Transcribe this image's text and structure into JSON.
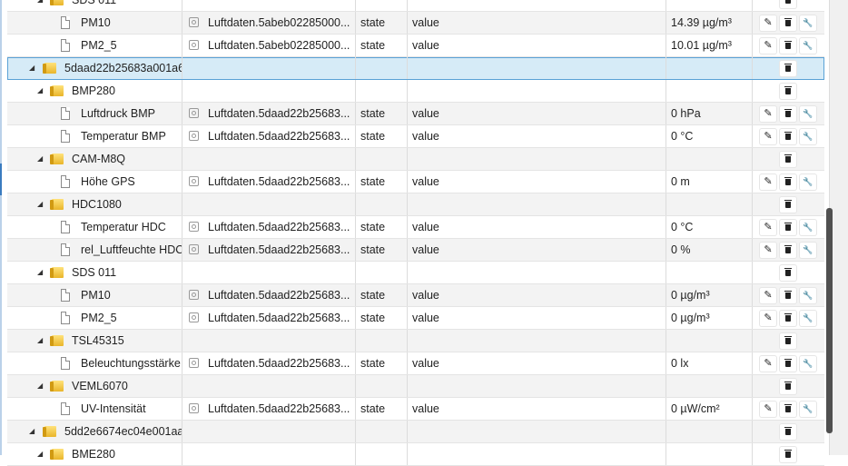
{
  "icons": {
    "expand": "triangle-down-icon",
    "folder": "folder-icon",
    "state": "document-icon",
    "object": "object-state-icon",
    "edit": "pencil-icon",
    "delete": "trash-icon",
    "settings": "wrench-icon"
  },
  "colors": {
    "selected_bg": "#d6ebf7",
    "selected_border": "#5aa2d6",
    "folder": "#e9b52a"
  },
  "rows": [
    {
      "kind": "folder",
      "level": 1,
      "name": "SDS 011",
      "actions": "delete"
    },
    {
      "kind": "state",
      "level": 2,
      "name": "PM10",
      "id": "Luftdaten.5abeb02285000...",
      "role": "state",
      "type": "value",
      "value": "14.39 µg/m³",
      "actions": "all"
    },
    {
      "kind": "state",
      "level": 2,
      "name": "PM2_5",
      "id": "Luftdaten.5abeb02285000...",
      "role": "state",
      "type": "value",
      "value": "10.01 µg/m³",
      "actions": "all"
    },
    {
      "kind": "folder",
      "level": 0,
      "name": "5daad22b25683a001a6",
      "actions": "delete",
      "selected": true
    },
    {
      "kind": "folder",
      "level": 1,
      "name": "BMP280",
      "actions": "delete"
    },
    {
      "kind": "state",
      "level": 2,
      "name": "Luftdruck BMP",
      "id": "Luftdaten.5daad22b25683...",
      "role": "state",
      "type": "value",
      "value": "0 hPa",
      "actions": "all"
    },
    {
      "kind": "state",
      "level": 2,
      "name": "Temperatur BMP",
      "id": "Luftdaten.5daad22b25683...",
      "role": "state",
      "type": "value",
      "value": "0 °C",
      "actions": "all"
    },
    {
      "kind": "folder",
      "level": 1,
      "name": "CAM-M8Q",
      "actions": "delete"
    },
    {
      "kind": "state",
      "level": 2,
      "name": "Höhe GPS",
      "id": "Luftdaten.5daad22b25683...",
      "role": "state",
      "type": "value",
      "value": "0 m",
      "actions": "all"
    },
    {
      "kind": "folder",
      "level": 1,
      "name": "HDC1080",
      "actions": "delete"
    },
    {
      "kind": "state",
      "level": 2,
      "name": "Temperatur HDC",
      "id": "Luftdaten.5daad22b25683...",
      "role": "state",
      "type": "value",
      "value": "0 °C",
      "actions": "all"
    },
    {
      "kind": "state",
      "level": 2,
      "name": "rel_Luftfeuchte HDC",
      "id": "Luftdaten.5daad22b25683...",
      "role": "state",
      "type": "value",
      "value": "0 %",
      "actions": "all"
    },
    {
      "kind": "folder",
      "level": 1,
      "name": "SDS 011",
      "actions": "delete"
    },
    {
      "kind": "state",
      "level": 2,
      "name": "PM10",
      "id": "Luftdaten.5daad22b25683...",
      "role": "state",
      "type": "value",
      "value": "0 µg/m³",
      "actions": "all"
    },
    {
      "kind": "state",
      "level": 2,
      "name": "PM2_5",
      "id": "Luftdaten.5daad22b25683...",
      "role": "state",
      "type": "value",
      "value": "0 µg/m³",
      "actions": "all"
    },
    {
      "kind": "folder",
      "level": 1,
      "name": "TSL45315",
      "actions": "delete"
    },
    {
      "kind": "state",
      "level": 2,
      "name": "Beleuchtungsstärke",
      "id": "Luftdaten.5daad22b25683...",
      "role": "state",
      "type": "value",
      "value": "0 lx",
      "actions": "all"
    },
    {
      "kind": "folder",
      "level": 1,
      "name": "VEML6070",
      "actions": "delete"
    },
    {
      "kind": "state",
      "level": 2,
      "name": "UV-Intensität",
      "id": "Luftdaten.5daad22b25683...",
      "role": "state",
      "type": "value",
      "value": "0 µW/cm²",
      "actions": "all"
    },
    {
      "kind": "folder",
      "level": 0,
      "name": "5dd2e6674ec04e001aa",
      "actions": "delete"
    },
    {
      "kind": "folder",
      "level": 1,
      "name": "BME280",
      "actions": "delete"
    }
  ]
}
